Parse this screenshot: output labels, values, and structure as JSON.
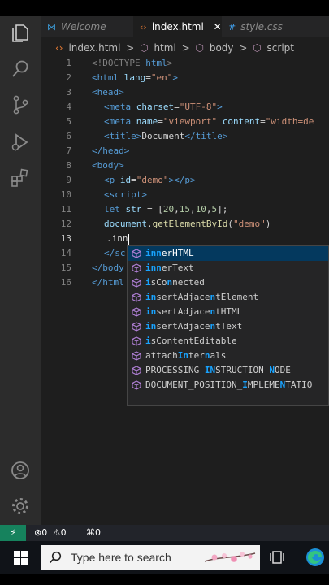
{
  "tabs": [
    {
      "label": "Welcome",
      "icon": "vscode-icon"
    },
    {
      "label": "index.html",
      "icon": "html-icon",
      "close": "✕"
    },
    {
      "label": "style.css",
      "icon": "css-icon",
      "glyph": "#"
    }
  ],
  "breadcrumb": [
    "index.html",
    "html",
    "body",
    "script"
  ],
  "breadcrumb_sep": ">",
  "gutter": [
    "1",
    "2",
    "3",
    "4",
    "5",
    "6",
    "7",
    "8",
    "9",
    "10",
    "11",
    "12",
    "13",
    "14",
    "15",
    "16"
  ],
  "code": {
    "l1": {
      "open": "<!DOCTYPE ",
      "kw": "html",
      "close": ">"
    },
    "l2": {
      "open": "<html ",
      "attr": "lang",
      "eq": "=",
      "val": "\"en\"",
      "close": ">"
    },
    "l3": "<head>",
    "l4": {
      "open": "<meta ",
      "attr": "charset",
      "eq": "=",
      "val": "\"UTF-8\"",
      "close": ">"
    },
    "l5": {
      "open": "<meta ",
      "attr1": "name",
      "eq1": "=",
      "val1": "\"viewport\"",
      "attr2": " content",
      "eq2": "=",
      "val2": "\"width=de"
    },
    "l6": {
      "open": "<title>",
      "text": "Document",
      "close": "</title>"
    },
    "l7": "</head>",
    "l8": "<body>",
    "l9": {
      "open": "<p ",
      "attr": "id",
      "eq": "=",
      "val": "\"demo\"",
      "close": "></p>"
    },
    "l10": "<script>",
    "l11": {
      "kw": "let ",
      "var": "str",
      "eq": " = [",
      "n1": "20",
      "c1": ",",
      "n2": "15",
      "c2": ",",
      "n3": "10",
      "c3": ",",
      "n4": "5",
      "end": "];"
    },
    "l12": {
      "obj": "document",
      "dot": ".",
      "fn": "getElementById",
      "p1": "(",
      "str": "\"demo\"",
      "p2": ")"
    },
    "l13": ".inn",
    "l14": "</sc",
    "l15": "</body",
    "l16": "</html"
  },
  "suggestions": [
    {
      "pre": "",
      "hl": "inn",
      "post": "erHTML"
    },
    {
      "pre": "",
      "hl": "inn",
      "post": "erText"
    },
    {
      "pre": "",
      "hl": "i",
      "mid": "sCo",
      "hl2": "n",
      "post": "nected"
    },
    {
      "pre": "",
      "hl": "in",
      "mid": "sertAdjace",
      "hl2": "n",
      "post": "tElement"
    },
    {
      "pre": "",
      "hl": "in",
      "mid": "sertAdjace",
      "hl2": "n",
      "post": "tHTML"
    },
    {
      "pre": "",
      "hl": "in",
      "mid": "sertAdjace",
      "hl2": "n",
      "post": "tText"
    },
    {
      "pre": "",
      "hl": "i",
      "mid": "sContentEditable",
      "hl2": "",
      "post": ""
    },
    {
      "pre": "attach",
      "hl": "In",
      "mid": "ter",
      "hl2": "n",
      "post": "als"
    },
    {
      "pre": "PROCESSING_",
      "hl": "IN",
      "mid": "STRUCTION_",
      "hl2": "N",
      "post": "ODE"
    },
    {
      "pre": "DOCUMENT_POSITION_",
      "hl": "I",
      "mid": "MPLEME",
      "hl2": "N",
      "post": "TATIO"
    }
  ],
  "status": {
    "errors": "0",
    "warnings": "0",
    "ports": "0"
  },
  "taskbar": {
    "search_placeholder": "Type here to search"
  },
  "colors": {
    "accent": "#18a3ff",
    "status_remote": "#16825d",
    "editor_bg": "#1e1e1e"
  }
}
